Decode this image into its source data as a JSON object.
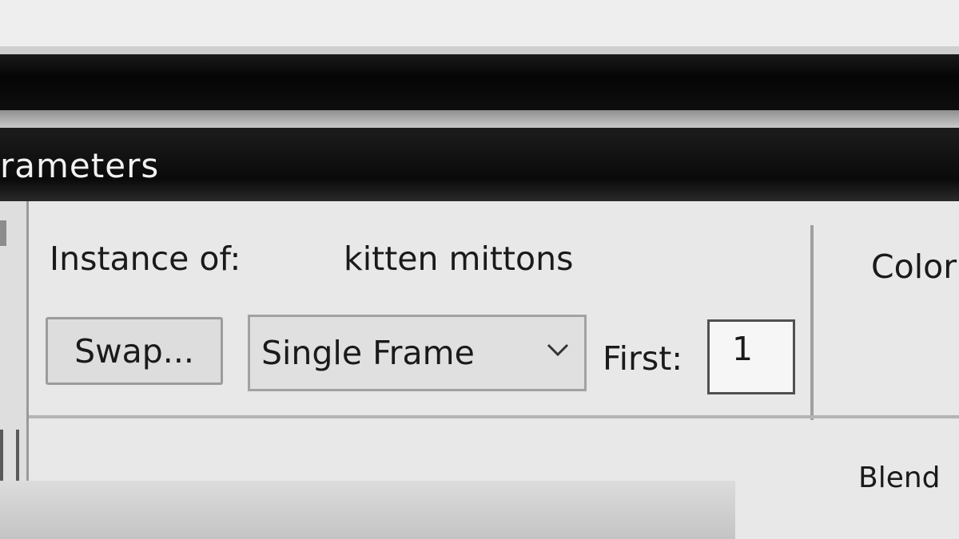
{
  "panel": {
    "title": "rameters"
  },
  "instance": {
    "label": "Instance of:",
    "value": "kitten mittons"
  },
  "controls": {
    "swap_label": "Swap...",
    "frame_mode": {
      "selected": "Single Frame",
      "icon": "chevron-down-icon"
    },
    "first_label": "First:",
    "first_value": "1"
  },
  "right_column": {
    "color_label": "Color",
    "blend_label": "Blend"
  }
}
